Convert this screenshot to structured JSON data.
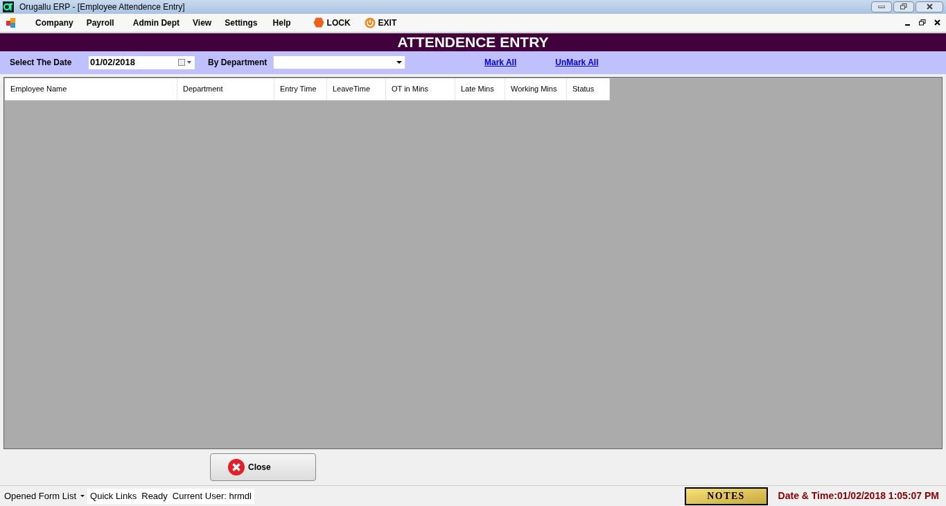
{
  "window": {
    "title": "Orugallu ERP - [Employee Attendence Entry]"
  },
  "menu": [
    {
      "label": "Company",
      "kind": "menu"
    },
    {
      "label": "Payroll",
      "kind": "menu"
    },
    {
      "label": "Admin Dept",
      "kind": "menu"
    },
    {
      "label": "View",
      "kind": "menu"
    },
    {
      "label": "Settings",
      "kind": "menu"
    },
    {
      "label": "Help",
      "kind": "menu"
    },
    {
      "label": "LOCK",
      "kind": "lock"
    },
    {
      "label": "EXIT",
      "kind": "exit"
    }
  ],
  "heading": "ATTENDENCE ENTRY",
  "filters": {
    "date_label": "Select The Date",
    "date_value": "01/02/2018",
    "department_label": "By Department",
    "mark_all": "Mark All",
    "unmark_all": "UnMark All"
  },
  "table": {
    "columns": [
      "Employee Name",
      "Department",
      "Entry Time",
      "LeaveTime",
      "OT in Mins",
      "Late Mins",
      "Working Mins",
      "Status"
    ]
  },
  "close_button": "Close",
  "status_bar": {
    "opened_form_list": "Opened Form List",
    "quick_links": "Quick Links",
    "ready": "Ready",
    "current_user": "Current User: hrmdl",
    "notes": "NOTES",
    "date_time": "Date & Time:01/02/2018 1:05:07 PM"
  }
}
